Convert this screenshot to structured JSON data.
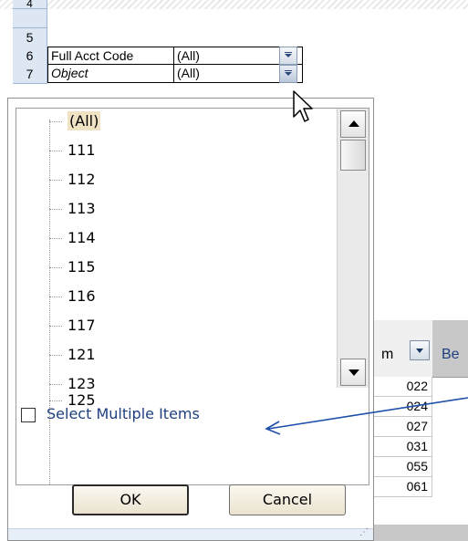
{
  "row_headers": [
    "4",
    "5",
    "6",
    "7"
  ],
  "filters": [
    {
      "label": "Full Acct Code",
      "value": "(All)"
    },
    {
      "label": "Object",
      "value": "(All)"
    }
  ],
  "dropdown": {
    "items": [
      "(All)",
      "111",
      "112",
      "113",
      "114",
      "115",
      "116",
      "117",
      "121",
      "123",
      "125"
    ],
    "selected": "(All)",
    "select_multiple_label": "Select Multiple Items",
    "select_multiple_checked": false,
    "ok_label": "OK",
    "cancel_label": "Cancel"
  },
  "pivot": {
    "column_header_fragment": "m",
    "next_header_fragment": "Be",
    "values": [
      "022",
      "024",
      "027",
      "031",
      "055",
      "061"
    ]
  },
  "colors": {
    "row_header_bg": "#dde6f3",
    "link_text": "#1f3f7f",
    "arrow": "#1f4fa8"
  },
  "icons": [
    "dropdown-arrow-icon",
    "mouse-pointer-icon",
    "scroll-up-icon",
    "scroll-down-icon",
    "annotation-arrow-icon",
    "resize-grip-icon"
  ]
}
